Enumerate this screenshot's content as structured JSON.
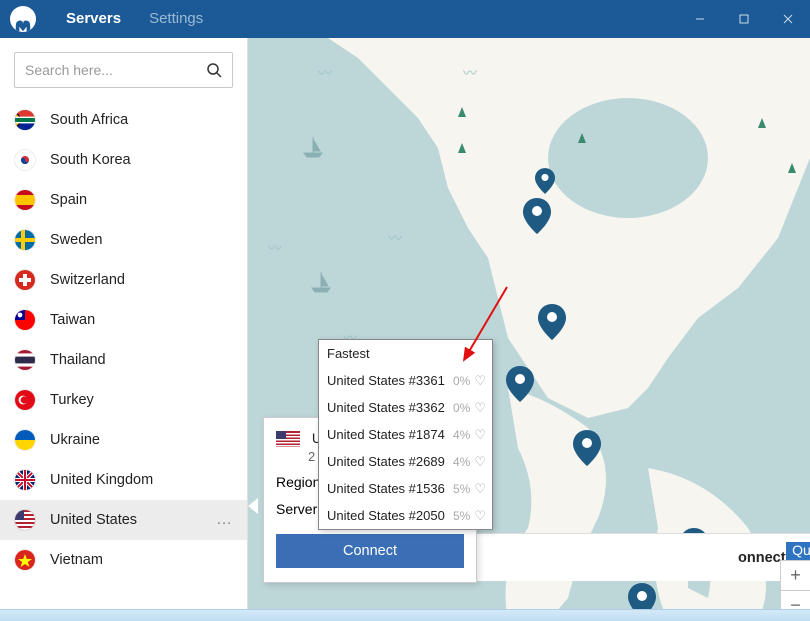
{
  "titlebar": {
    "tab_servers": "Servers",
    "tab_settings": "Settings"
  },
  "search": {
    "placeholder": "Search here..."
  },
  "countries": [
    {
      "name": "South Africa"
    },
    {
      "name": "South Korea"
    },
    {
      "name": "Spain"
    },
    {
      "name": "Sweden"
    },
    {
      "name": "Switzerland"
    },
    {
      "name": "Taiwan"
    },
    {
      "name": "Thailand"
    },
    {
      "name": "Turkey"
    },
    {
      "name": "Ukraine"
    },
    {
      "name": "United Kingdom"
    },
    {
      "name": "United States",
      "active": true
    },
    {
      "name": "Vietnam"
    }
  ],
  "dropdown": {
    "header": "Fastest",
    "items": [
      {
        "name": "United States #3361",
        "pct": "0%"
      },
      {
        "name": "United States #3362",
        "pct": "0%"
      },
      {
        "name": "United States #1874",
        "pct": "4%"
      },
      {
        "name": "United States #2689",
        "pct": "4%"
      },
      {
        "name": "United States #1536",
        "pct": "5%"
      },
      {
        "name": "United States #2050",
        "pct": "5%"
      }
    ]
  },
  "card": {
    "region_label": "Region:",
    "server_label": "Server:",
    "server_value": "Fastest",
    "connect_label": "Connect"
  },
  "status": {
    "text": "onnect"
  },
  "quick_connect": {
    "label": "Quick connect"
  },
  "zoom": {
    "plus": "+",
    "minus": "−"
  },
  "dots": "…"
}
